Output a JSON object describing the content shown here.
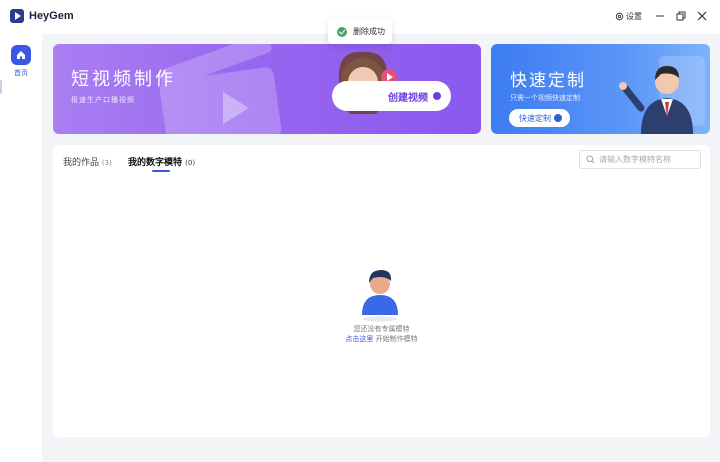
{
  "app": {
    "name": "HeyGem"
  },
  "titlebar": {
    "settings_label": "设置"
  },
  "toast": {
    "message": "删除成功"
  },
  "sidebar": {
    "items": [
      {
        "label": "首页"
      }
    ]
  },
  "banners": {
    "short_video": {
      "title": "短视频制作",
      "subtitle": "极速生产口播视频",
      "button_label": "创建视频"
    },
    "quick_custom": {
      "title": "快速定制",
      "subtitle": "只需一个视频快速定制",
      "button_label": "快速定制"
    }
  },
  "tabs": [
    {
      "label": "我的作品",
      "count": "(3)"
    },
    {
      "label": "我的数字模特",
      "count": "(0)"
    }
  ],
  "search": {
    "placeholder": "请输入数字模特名称"
  },
  "empty_state": {
    "message": "您还没有专属模特",
    "link_text": "点击这里",
    "link_suffix": " 开始制作模特"
  },
  "colors": {
    "accent": "#3b56e6",
    "banner_purple": "#9867f0",
    "banner_blue": "#5a95f7",
    "success": "#3fa66b"
  }
}
